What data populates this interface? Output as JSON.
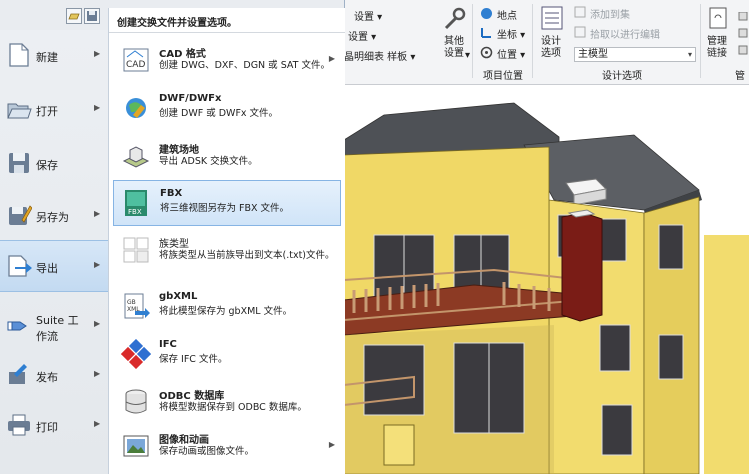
{
  "ribbon": {
    "settings1": "设置 ▾",
    "settings2": "设置 ▾",
    "browse_row": "晶明细表 样板 ▾",
    "other_settings": "其他设置",
    "other_settings_arrow": "▾",
    "location": "地点",
    "coordinates": "坐标 ▾",
    "position": "位置 ▾",
    "project_location_group": "项目位置",
    "design_options_btn": "设计选项",
    "add_to_set": "添加到集",
    "pick_to_edit": "拾取以进行编辑",
    "main_model": "主模型",
    "design_options_group": "设计选项",
    "manage_links": "管理链接",
    "manage_group_partial": "管"
  },
  "app_menu": {
    "quick_access": [
      "open-icon",
      "save-icon"
    ],
    "left_items": [
      {
        "label": "新建",
        "icon": "new-icon",
        "arrow": "▶"
      },
      {
        "label": "打开",
        "icon": "open-folder-icon",
        "arrow": "▶"
      },
      {
        "label": "保存",
        "icon": "save-icon",
        "arrow": ""
      },
      {
        "label": "另存为",
        "icon": "save-as-icon",
        "arrow": "▶"
      },
      {
        "label": "导出",
        "icon": "export-icon",
        "arrow": "▶"
      },
      {
        "label": "Suite 工作流",
        "icon": "suite-workflow-icon",
        "arrow": "▶"
      },
      {
        "label": "发布",
        "icon": "publish-icon",
        "arrow": "▶"
      },
      {
        "label": "打印",
        "icon": "print-icon",
        "arrow": "▶"
      }
    ],
    "panel_title": "创建交换文件并设置选项。",
    "options": [
      {
        "title": "CAD 格式",
        "desc": "创建 DWG、DXF、DGN 或 SAT 文件。",
        "icon": "cad-icon",
        "arrow": "▶"
      },
      {
        "title": "DWF/DWFx",
        "desc": "创建 DWF 或 DWFx 文件。",
        "icon": "dwf-globe-icon",
        "arrow": ""
      },
      {
        "title": "建筑场地",
        "desc": "导出 ADSK 交换文件。",
        "icon": "building-site-icon",
        "arrow": ""
      },
      {
        "title": "FBX",
        "desc": "将三维视图另存为 FBX 文件。",
        "icon": "fbx-icon",
        "arrow": ""
      },
      {
        "title": "族类型",
        "desc": "将族类型从当前族导出到文本(.txt)文件。",
        "icon": "family-types-icon",
        "arrow": ""
      },
      {
        "title": "gbXML",
        "desc": "将此模型保存为 gbXML 文件。",
        "icon": "gbxml-icon",
        "arrow": ""
      },
      {
        "title": "IFC",
        "desc": "保存 IFC 文件。",
        "icon": "ifc-icon",
        "arrow": ""
      },
      {
        "title": "ODBC 数据库",
        "desc": "将模型数据保存到 ODBC 数据库。",
        "icon": "database-icon",
        "arrow": ""
      },
      {
        "title": "图像和动画",
        "desc": "保存动画或图像文件。",
        "icon": "image-animation-icon",
        "arrow": "▶"
      }
    ]
  },
  "colors": {
    "roof": "#55585d",
    "wall": "#f2dc6e",
    "chimney": "#7a1c16",
    "highlight": "#cfe3f7"
  }
}
